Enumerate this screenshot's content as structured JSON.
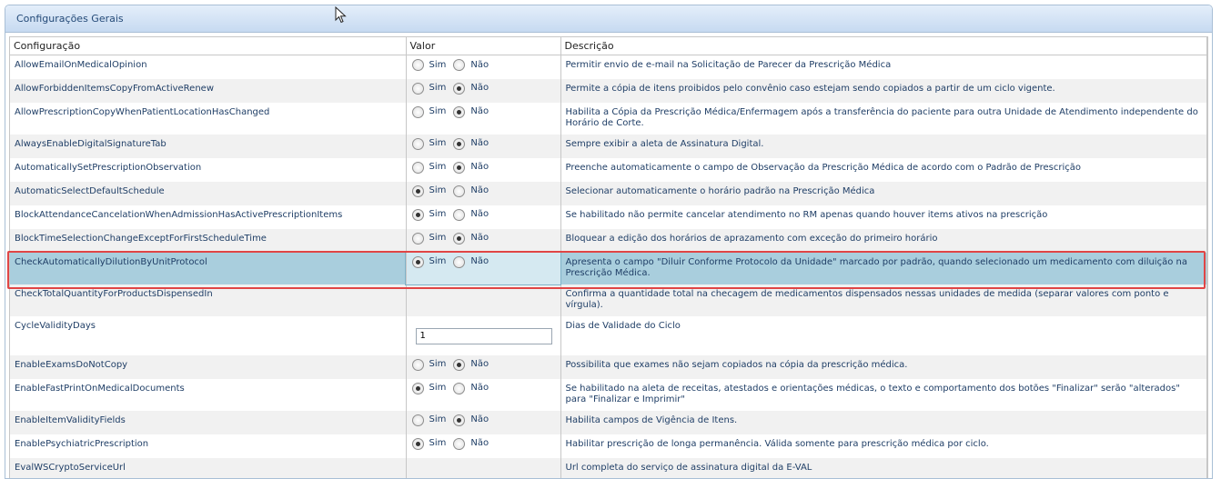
{
  "panel": {
    "title": "Configurações Gerais"
  },
  "columns": {
    "config": "Configuração",
    "value": "Valor",
    "desc": "Descrição"
  },
  "radio_labels": {
    "yes": "Sim",
    "no": "Não"
  },
  "rows": [
    {
      "name": "AllowEmailOnMedicalOpinion",
      "selected": "none",
      "desc": "Permitir envio de e-mail na Solicitação de Parecer da Prescrição Médica"
    },
    {
      "name": "AllowForbiddenItemsCopyFromActiveRenew",
      "selected": "no",
      "desc": "Permite a cópia de itens proibidos pelo convênio caso estejam sendo copiados a partir de um ciclo vigente."
    },
    {
      "name": "AllowPrescriptionCopyWhenPatientLocationHasChanged",
      "selected": "no",
      "desc": "Habilita a Cópia da Prescrição Médica/Enfermagem após a transferência do paciente para outra Unidade de Atendimento independente do Horário de Corte."
    },
    {
      "name": "AlwaysEnableDigitalSignatureTab",
      "selected": "no",
      "desc": "Sempre exibir a aleta de Assinatura Digital."
    },
    {
      "name": "AutomaticallySetPrescriptionObservation",
      "selected": "no",
      "desc": "Preenche automaticamente o campo de Observação da Prescrição Médica de acordo com o Padrão de Prescrição"
    },
    {
      "name": "AutomaticSelectDefaultSchedule",
      "selected": "yes",
      "desc": "Selecionar automaticamente o horário padrão na Prescrição Médica"
    },
    {
      "name": "BlockAttendanceCancelationWhenAdmissionHasActivePrescriptionItems",
      "selected": "yes",
      "desc": "Se habilitado não permite cancelar atendimento no RM apenas quando houver items ativos na prescrição"
    },
    {
      "name": "BlockTimeSelectionChangeExceptForFirstScheduleTime",
      "selected": "no",
      "desc": "Bloquear a edição dos horários de aprazamento com exceção do primeiro horário"
    },
    {
      "name": "CheckAutomaticallyDilutionByUnitProtocol",
      "selected": "yes",
      "desc": "Apresenta o campo \"Diluir Conforme Protocolo da Unidade\" marcado por padrão, quando selecionado um medicamento com diluição na Prescrição Médica."
    },
    {
      "name": "CheckTotalQuantityForProductsDispensedIn",
      "selected": "none",
      "desc": "Confirma a quantidade total na checagem de medicamentos dispensados nessas unidades de medida (separar valores com ponto e vírgula)."
    },
    {
      "name": "CycleValidityDays",
      "selected": "input",
      "input_value": "1",
      "desc": "Dias de Validade do Ciclo"
    },
    {
      "name": "EnableExamsDoNotCopy",
      "selected": "no",
      "desc": "Possibilita que exames não sejam copiados na cópia da prescrição médica."
    },
    {
      "name": "EnableFastPrintOnMedicalDocuments",
      "selected": "yes",
      "desc": "Se habilitado na aleta de receitas, atestados e orientações médicas, o texto e comportamento dos botões \"Finalizar\" serão \"alterados\" para \"Finalizar e Imprimir\""
    },
    {
      "name": "EnableItemValidityFields",
      "selected": "no",
      "desc": "Habilita campos de Vigência de Itens."
    },
    {
      "name": "EnablePsychiatricPrescription",
      "selected": "yes",
      "desc": "Habilitar prescrição de longa permanência. Válida somente para prescrição médica por ciclo."
    },
    {
      "name": "EvalWSCryptoServiceUrl",
      "selected": "empty",
      "desc": "Url completa do serviço de assinatura digital da E-VAL"
    }
  ]
}
